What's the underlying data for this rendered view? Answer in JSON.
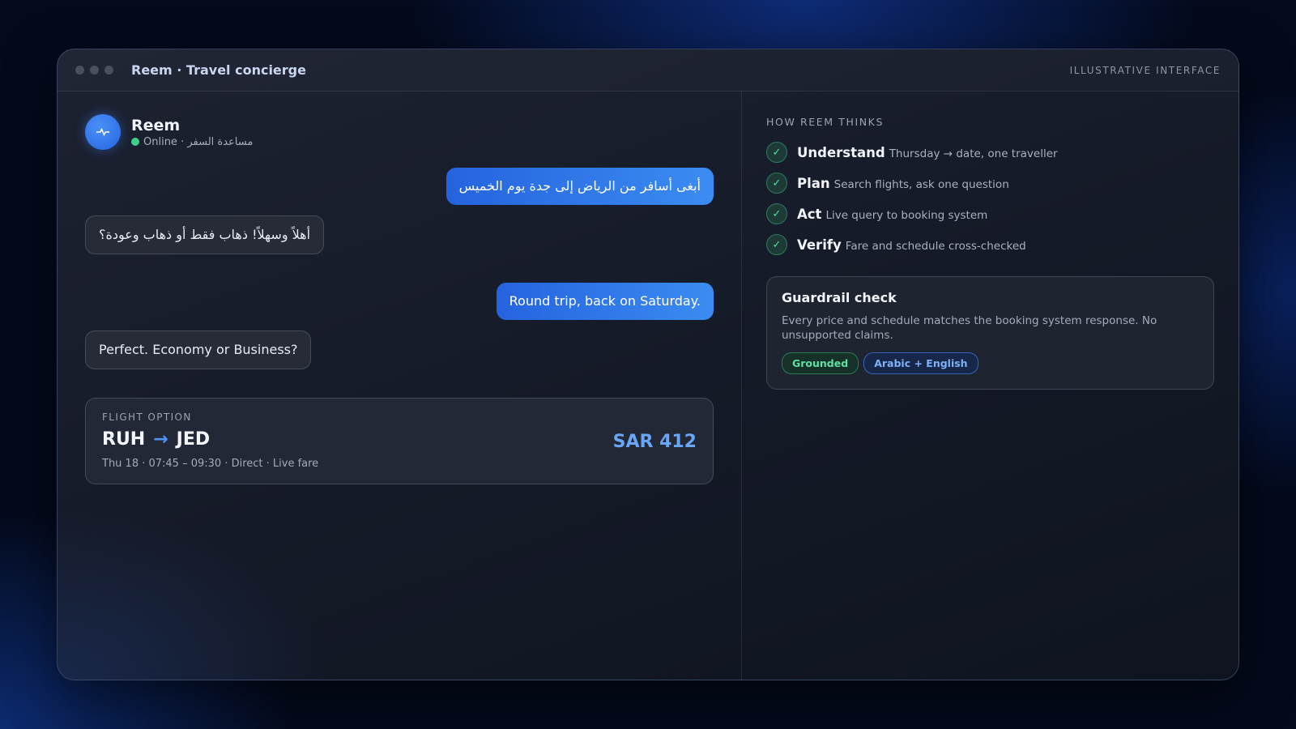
{
  "window": {
    "title": "Reem · Travel concierge",
    "badge": "ILLUSTRATIVE INTERFACE"
  },
  "agent": {
    "name": "Reem",
    "status": "Online · مساعدة السفر",
    "avatar_icon": "pulse-icon"
  },
  "messages": [
    {
      "from": "user",
      "text": "أبغى أسافر من الرياض إلى جدة يوم الخميس"
    },
    {
      "from": "agent",
      "text": "أهلاً وسهلاً! ذهاب فقط أو ذهاب وعودة؟"
    },
    {
      "from": "user",
      "text": "Round trip, back on Saturday."
    },
    {
      "from": "agent",
      "text": "Perfect. Economy or Business?"
    }
  ],
  "flight": {
    "label": "FLIGHT OPTION",
    "origin": "RUH",
    "arrow": "→",
    "destination": "JED",
    "meta": "Thu 18 · 07:45 – 09:30 · Direct · Live fare",
    "price": "SAR 412"
  },
  "thinking": {
    "label": "HOW REEM THINKS",
    "steps": [
      {
        "title": "Understand",
        "desc": "Thursday → date, one traveller"
      },
      {
        "title": "Plan",
        "desc": "Search flights, ask one question"
      },
      {
        "title": "Act",
        "desc": "Live query to booking system"
      },
      {
        "title": "Verify",
        "desc": "Fare and schedule cross-checked"
      }
    ]
  },
  "guardrail": {
    "title": "Guardrail check",
    "text": "Every price and schedule matches the booking system response. No unsupported claims.",
    "tags": [
      "Grounded",
      "Arabic + English"
    ]
  },
  "colors": {
    "accent": "#2f7cf0",
    "online": "#3ed08a",
    "price": "#6aa6f7"
  }
}
